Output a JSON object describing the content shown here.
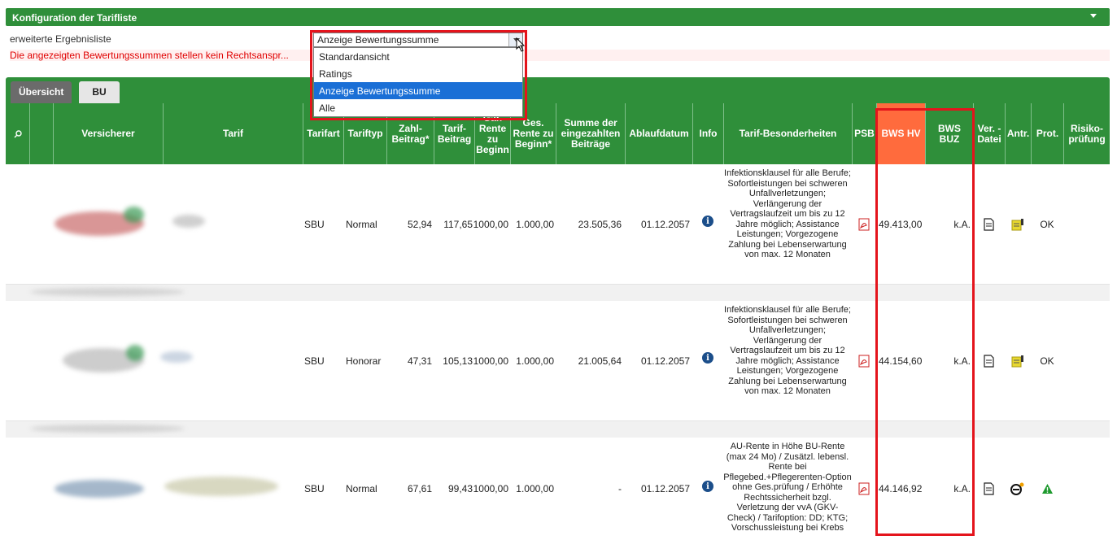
{
  "config": {
    "title": "Konfiguration der Tarifliste",
    "field_label": "erweiterte Ergebnisliste",
    "warning": "Die angezeigten Bewertungssummen stellen kein Rechtsanspr...",
    "select_value": "Anzeige Bewertungssumme",
    "options": [
      "Standardansicht",
      "Ratings",
      "Anzeige Bewertungssumme",
      "Alle"
    ]
  },
  "tabs": {
    "overview": "Übersicht",
    "bu": "BU"
  },
  "columns": {
    "versicherer": "Versicherer",
    "tarif": "Tarif",
    "tarifart": "Tarifart",
    "tariftyp": "Tariftyp",
    "zahlbeitrag": "Zahl-Beitrag*",
    "tarifbeitrag": "Tarif-Beitrag",
    "garrente": "Gar. Rente zu Beginn",
    "gesrente": "Ges. Rente zu Beginn*",
    "summe": "Summe der eingezahlten Beiträge",
    "ablauf": "Ablaufdatum",
    "info": "Info",
    "besonderheiten": "Tarif-Besonderheiten",
    "psb": "PSB",
    "bws_hv": "BWS HV",
    "bws_buz": "BWS BUZ",
    "ver_datei": "Ver. -Datei",
    "antr": "Antr.",
    "prot": "Prot.",
    "risiko": "Risiko-prüfung"
  },
  "rows": [
    {
      "tarifart": "SBU",
      "tariftyp": "Normal",
      "zahlbeitrag": "52,94",
      "tarifbeitrag": "117,65",
      "garrente": "1000,00",
      "gesrente": "1.000,00",
      "summe": "23.505,36",
      "ablauf": "01.12.2057",
      "features": "Infektionsklausel für alle Berufe; Sofortleistungen bei schweren Unfallverletzungen; Verlängerung der Vertragslaufzeit um bis zu 12 Jahre möglich; Assistance Leistungen; Vorgezogene Zahlung bei Lebenserwartung von max. 12 Monaten",
      "bws_hv": "49.413,00",
      "bws_buz": "k.A.",
      "risiko": "OK"
    },
    {
      "tarifart": "SBU",
      "tariftyp": "Honorar",
      "zahlbeitrag": "47,31",
      "tarifbeitrag": "105,13",
      "garrente": "1000,00",
      "gesrente": "1.000,00",
      "summe": "21.005,64",
      "ablauf": "01.12.2057",
      "features": "Infektionsklausel für alle Berufe; Sofortleistungen bei schweren Unfallverletzungen; Verlängerung der Vertragslaufzeit um bis zu 12 Jahre möglich; Assistance Leistungen; Vorgezogene Zahlung bei Lebenserwartung von max. 12 Monaten",
      "bws_hv": "44.154,60",
      "bws_buz": "k.A.",
      "risiko": "OK"
    },
    {
      "tarifart": "SBU",
      "tariftyp": "Normal",
      "zahlbeitrag": "67,61",
      "tarifbeitrag": "99,43",
      "garrente": "1000,00",
      "gesrente": "1.000,00",
      "summe": "-",
      "ablauf": "01.12.2057",
      "features": "AU-Rente in Höhe BU-Rente (max 24 Mo) / Zusätzl. lebensl. Rente bei Pflegebed.+Pflegerenten-Option ohne Ges.prüfung / Erhöhte Rechtssicherheit bzgl. Verletzung der vvA (GKV-Check) / Tarifoption: DD; KTG; Vorschussleistung bei Krebs",
      "bws_hv": "44.146,92",
      "bws_buz": "k.A.",
      "risiko": ""
    }
  ],
  "colors": {
    "green": "#2f8f3a",
    "highlight": "#ff6b3d",
    "frame": "#e4141c",
    "select": "#1a6fd6"
  }
}
